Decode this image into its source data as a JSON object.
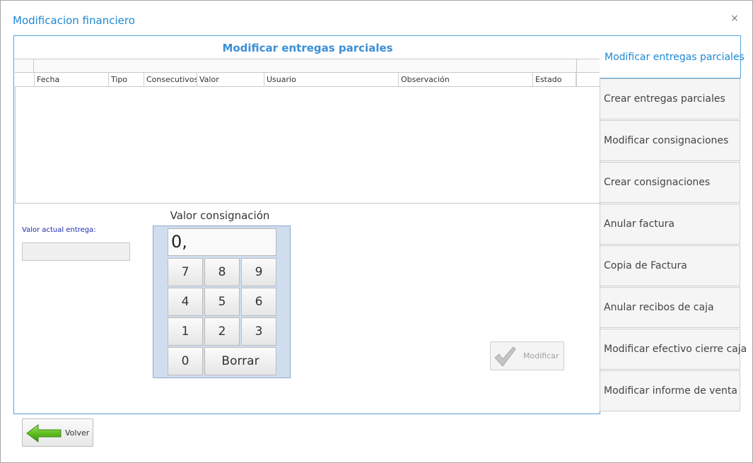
{
  "window": {
    "title": "Modificacion financiero",
    "close_glyph": "×"
  },
  "panel": {
    "title": "Modificar entregas parciales"
  },
  "grid": {
    "columns": [
      "Fecha",
      "Tipo",
      "Consecutivos",
      "Valor",
      "Usuario",
      "Observación",
      "Estado"
    ],
    "rows": []
  },
  "form": {
    "valor_actual_label": "Valor actual entrega:",
    "valor_actual_value": "",
    "consignacion_label": "Valor consignación",
    "display_value": "0,"
  },
  "keypad": {
    "keys": [
      "7",
      "8",
      "9",
      "4",
      "5",
      "6",
      "1",
      "2",
      "3",
      "0"
    ],
    "delete_label": "Borrar"
  },
  "buttons": {
    "modificar_label": "Modificar",
    "volver_label": "Volver"
  },
  "tabs": [
    {
      "label": "Modificar entregas parciales",
      "active": true
    },
    {
      "label": "Crear entregas parciales"
    },
    {
      "label": "Modificar consignaciones"
    },
    {
      "label": "Crear consignaciones"
    },
    {
      "label": "Anular factura"
    },
    {
      "label": "Copia de Factura"
    },
    {
      "label": "Anular recibos de caja"
    },
    {
      "label": "Modificar efectivo cierre caja"
    },
    {
      "label": "Modificar informe de venta"
    }
  ],
  "colors": {
    "accent": "#1e88d2",
    "keypad_bg": "#cfddef",
    "green_arrow": "#5fbf1f"
  }
}
